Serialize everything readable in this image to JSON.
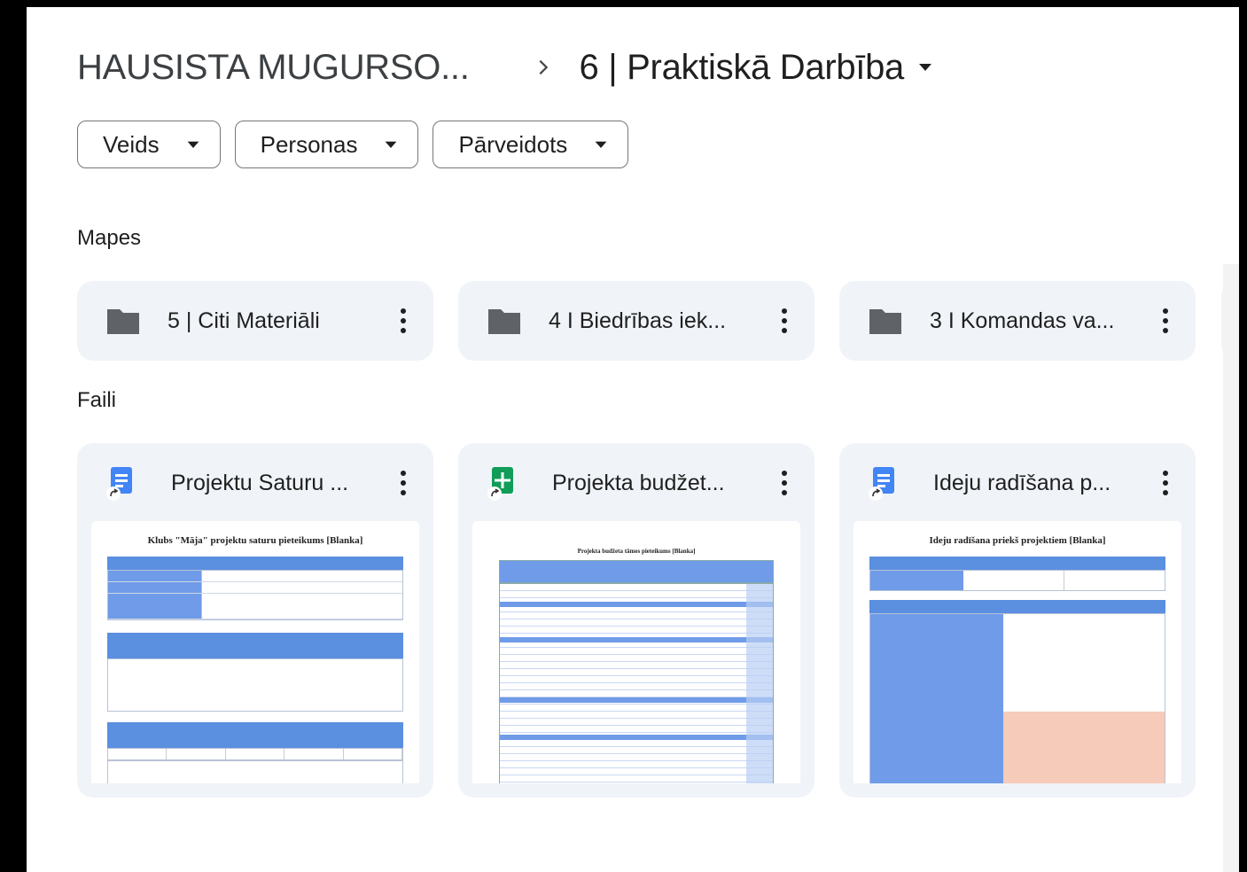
{
  "breadcrumb": {
    "root": "HAUSISTA MUGURSO...",
    "current": "6 | Praktiskā Darbība"
  },
  "filters": [
    {
      "label": "Veids"
    },
    {
      "label": "Personas"
    },
    {
      "label": "Pārveidots"
    }
  ],
  "sections": {
    "folders": "Mapes",
    "files": "Faili"
  },
  "folders": [
    {
      "name": "5 | Citi Materiāli"
    },
    {
      "name": "4 I Biedrības iek..."
    },
    {
      "name": "3 I Komandas va..."
    }
  ],
  "files": [
    {
      "name": "Projektu Saturu ...",
      "type": "doc",
      "thumb_title": "Klubs \"Māja\" projektu saturu pieteikums [Blanka]"
    },
    {
      "name": "Projekta budžet...",
      "type": "sheet",
      "thumb_title": "Projekta budžeta tāmes pieteikums [Blanka]"
    },
    {
      "name": "Ideju radīšana p...",
      "type": "doc",
      "thumb_title": "Ideju radīšana priekš projektiem [Blanka]"
    }
  ],
  "colors": {
    "card_bg": "#f0f4f9",
    "doc_blue": "#4285f4",
    "sheet_green": "#0f9d58"
  }
}
